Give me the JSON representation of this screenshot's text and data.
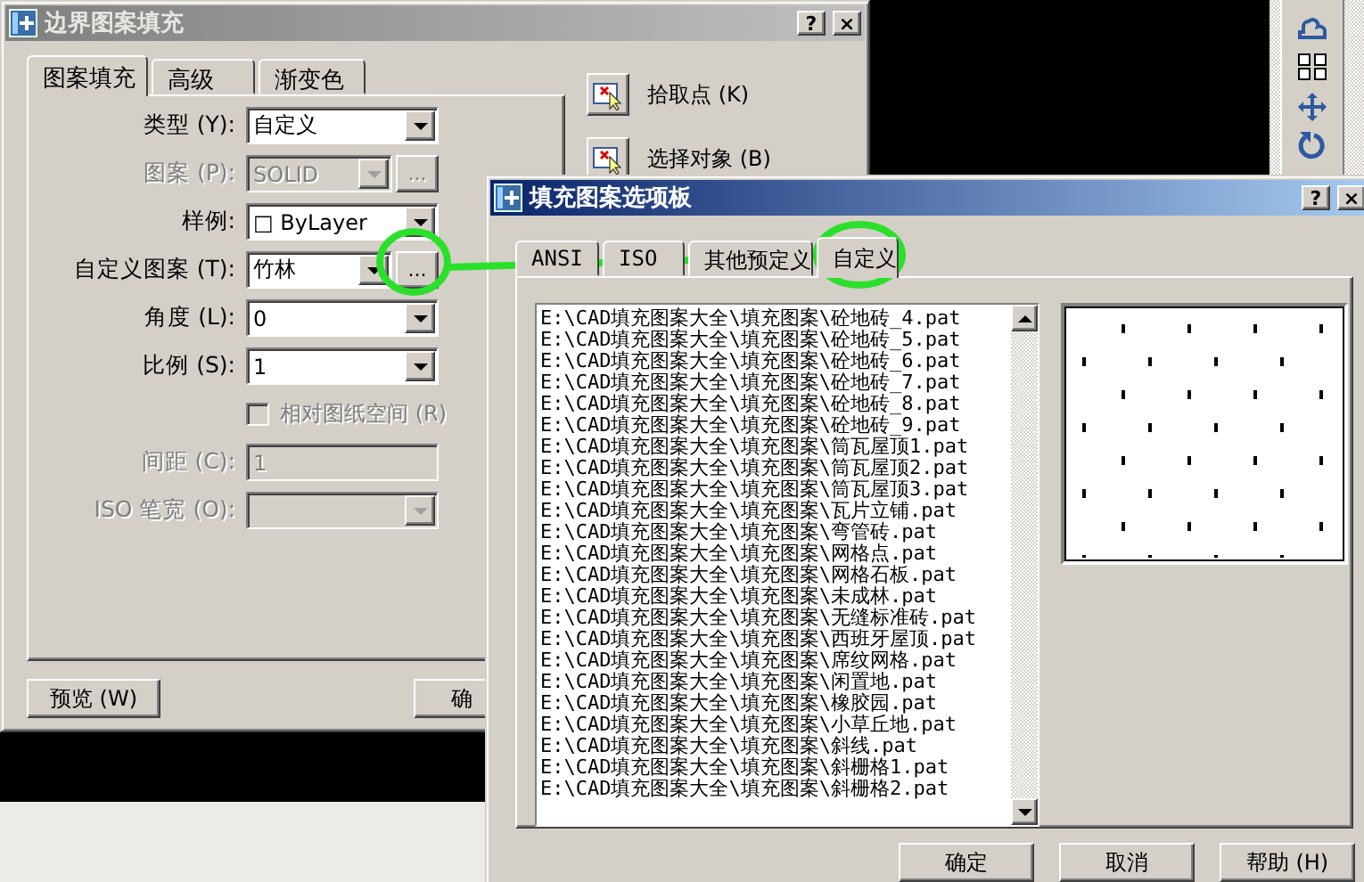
{
  "back_dialog": {
    "title": "边界图案填充",
    "help_button": "?",
    "close_button": "×",
    "tabs": [
      {
        "label": "图案填充",
        "selected": true
      },
      {
        "label": "高级",
        "selected": false
      },
      {
        "label": "渐变色",
        "selected": false
      }
    ],
    "fields": [
      {
        "kind": "dropdown",
        "label": "类型 (Y):",
        "value": "自定义",
        "disabled": false
      },
      {
        "kind": "dropdown",
        "label": "图案 (P):",
        "value": "SOLID",
        "disabled": true,
        "browse_button": "..."
      },
      {
        "kind": "dropdown",
        "label": "样例:",
        "value": "□ ByLayer",
        "disabled": false
      },
      {
        "kind": "dropdown",
        "label": "自定义图案 (T):",
        "value": "竹林",
        "disabled": false,
        "browse_button": "..."
      },
      {
        "kind": "dropdown",
        "label": "角度 (L):",
        "value": "0",
        "disabled": false
      },
      {
        "kind": "dropdown",
        "label": "比例 (S):",
        "value": "1",
        "disabled": false
      },
      {
        "kind": "checkbox",
        "label": "相对图纸空间 (R)",
        "checked": false,
        "disabled": true
      },
      {
        "kind": "text",
        "label": "间距 (C):",
        "value": "1",
        "disabled": true
      },
      {
        "kind": "dropdown",
        "label": "ISO 笔宽 (O):",
        "disabled": true
      }
    ],
    "side_buttons": [
      {
        "label": "拾取点 (K)"
      },
      {
        "label": "选择对象 (B)"
      }
    ],
    "preview_button": "预览 (W)",
    "ok_button": "确"
  },
  "front_dialog": {
    "title": "填充图案选项板",
    "help_button": "?",
    "close_button": "×",
    "tabs": [
      {
        "label": "ANSI",
        "selected": false
      },
      {
        "label": "ISO",
        "selected": false
      },
      {
        "label": "其他预定义",
        "selected": false
      },
      {
        "label": "自定义",
        "selected": true
      }
    ],
    "files": [
      "E:\\CAD填充图案大全\\填充图案\\砼地砖_4.pat",
      "E:\\CAD填充图案大全\\填充图案\\砼地砖_5.pat",
      "E:\\CAD填充图案大全\\填充图案\\砼地砖_6.pat",
      "E:\\CAD填充图案大全\\填充图案\\砼地砖_7.pat",
      "E:\\CAD填充图案大全\\填充图案\\砼地砖_8.pat",
      "E:\\CAD填充图案大全\\填充图案\\砼地砖_9.pat",
      "E:\\CAD填充图案大全\\填充图案\\筒瓦屋顶1.pat",
      "E:\\CAD填充图案大全\\填充图案\\筒瓦屋顶2.pat",
      "E:\\CAD填充图案大全\\填充图案\\筒瓦屋顶3.pat",
      "E:\\CAD填充图案大全\\填充图案\\瓦片立铺.pat",
      "E:\\CAD填充图案大全\\填充图案\\弯管砖.pat",
      "E:\\CAD填充图案大全\\填充图案\\网格点.pat",
      "E:\\CAD填充图案大全\\填充图案\\网格石板.pat",
      "E:\\CAD填充图案大全\\填充图案\\未成林.pat",
      "E:\\CAD填充图案大全\\填充图案\\无缝标准砖.pat",
      "E:\\CAD填充图案大全\\填充图案\\西班牙屋顶.pat",
      "E:\\CAD填充图案大全\\填充图案\\席纹网格.pat",
      "E:\\CAD填充图案大全\\填充图案\\闲置地.pat",
      "E:\\CAD填充图案大全\\填充图案\\橡胶园.pat",
      "E:\\CAD填充图案大全\\填充图案\\小草丘地.pat",
      "E:\\CAD填充图案大全\\填充图案\\斜线.pat",
      "E:\\CAD填充图案大全\\填充图案\\斜栅格1.pat",
      "E:\\CAD填充图案大全\\填充图案\\斜栅格2.pat"
    ],
    "buttons": [
      "确定",
      "取消",
      "帮助 (H)"
    ]
  }
}
